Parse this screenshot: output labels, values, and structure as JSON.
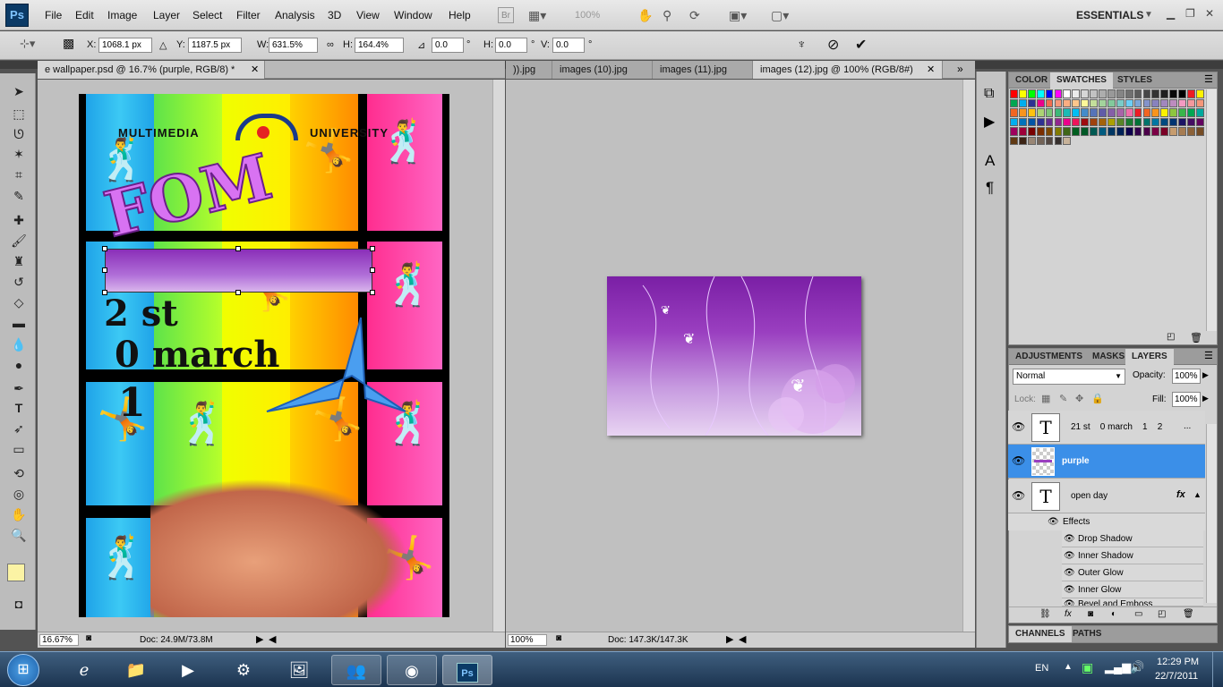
{
  "menubar": {
    "logo": "Ps",
    "items": [
      "File",
      "Edit",
      "Image",
      "Layer",
      "Select",
      "Filter",
      "Analysis",
      "3D",
      "View",
      "Window",
      "Help"
    ],
    "bridge_label": "Br",
    "zoom_value": "100%",
    "workspace": "ESSENTIALS"
  },
  "options": {
    "x_label": "X:",
    "x_value": "1068.1 px",
    "y_label": "Y:",
    "y_value": "1187.5 px",
    "w_label": "W:",
    "w_value": "631.5%",
    "h_label": "H:",
    "h_value": "164.4%",
    "angle_value": "0.0",
    "hskew_label": "H:",
    "hskew_value": "0.0",
    "vskew_label": "V:",
    "vskew_value": "0.0",
    "deg": "°"
  },
  "doc1": {
    "tab": "e wallpaper.psd @ 16.7% (purple, RGB/8) *",
    "zoom": "16.67%",
    "doc_info": "Doc: 24.9M/73.8M"
  },
  "poster": {
    "brand_left": "MULTIMEDIA",
    "brand_right": "UNIVERSITY",
    "title": "FOM",
    "date1": "2 st",
    "date2": "0 march",
    "date3": "1"
  },
  "doc2": {
    "tabs": [
      ")).jpg",
      "images (10).jpg",
      "images (11).jpg",
      "images (12).jpg @ 100% (RGB/8#)"
    ],
    "more": "»",
    "zoom": "100%",
    "doc_info": "Doc: 147.3K/147.3K"
  },
  "panel_top": {
    "tabs": [
      "COLOR",
      "SWATCHES",
      "STYLES"
    ]
  },
  "swatches": {
    "colors": [
      "#ff0000",
      "#ffff00",
      "#00ff00",
      "#00ffff",
      "#0000ff",
      "#ff00ff",
      "#ffffff",
      "#ebebeb",
      "#d6d6d6",
      "#c2c2c2",
      "#adadad",
      "#999999",
      "#858585",
      "#707070",
      "#5c5c5c",
      "#474747",
      "#333333",
      "#1f1f1f",
      "#0a0a0a",
      "#000000",
      "#ed1c24",
      "#fff200",
      "#00a651",
      "#00aeef",
      "#2e3192",
      "#ec008c",
      "#f26c4f",
      "#f7977a",
      "#fbad82",
      "#fdc68c",
      "#fff799",
      "#c4df9b",
      "#a3d39c",
      "#82ca9c",
      "#7accc8",
      "#6dcff6",
      "#7da7d8",
      "#8393ca",
      "#8882be",
      "#a187be",
      "#bc8cbf",
      "#f49ac1",
      "#f5989d",
      "#f69679",
      "#f26522",
      "#f7941d",
      "#ffc20e",
      "#acd373",
      "#7cc576",
      "#3cb878",
      "#1cbbb4",
      "#00bff3",
      "#448ccb",
      "#5674b9",
      "#605ca8",
      "#855fa8",
      "#a864a8",
      "#f06eaa",
      "#ed1c24",
      "#f26522",
      "#f7941d",
      "#fff200",
      "#8dc63f",
      "#39b54a",
      "#00a651",
      "#00a99d",
      "#00aeef",
      "#0072bc",
      "#0054a6",
      "#2e3192",
      "#662d91",
      "#92278f",
      "#ec008c",
      "#ed145b",
      "#9e0b0f",
      "#a0410d",
      "#a3620a",
      "#aba000",
      "#598527",
      "#197b30",
      "#007236",
      "#00746b",
      "#0076a3",
      "#004a80",
      "#003471",
      "#1b1464",
      "#440e62",
      "#630460",
      "#9e005d",
      "#9e0039",
      "#790000",
      "#7b2e00",
      "#7d4900",
      "#827b00",
      "#406618",
      "#005e20",
      "#005826",
      "#005952",
      "#005b7f",
      "#003663",
      "#002157",
      "#0d004c",
      "#32004b",
      "#4b0049",
      "#7b0046",
      "#7a0026",
      "#c69c6e",
      "#a67c52",
      "#8c6239",
      "#754c24",
      "#603913",
      "#3c2415",
      "#998675",
      "#736357",
      "#534741",
      "#362f2d",
      "#c7b299"
    ]
  },
  "panel_layers": {
    "tabs": [
      "ADJUSTMENTS",
      "MASKS",
      "LAYERS"
    ],
    "blend_mode": "Normal",
    "opacity_label": "Opacity:",
    "opacity_value": "100%",
    "lock_label": "Lock:",
    "fill_label": "Fill:",
    "fill_value": "100%",
    "layers": [
      {
        "name": "21 st    0 march    1    2",
        "thumb": "T",
        "extra": "..."
      },
      {
        "name": "purple",
        "thumb": "",
        "extra": ""
      },
      {
        "name": "open day",
        "thumb": "T",
        "extra": "fx"
      }
    ],
    "effects_label": "Effects",
    "effects": [
      "Drop Shadow",
      "Inner Shadow",
      "Outer Glow",
      "Inner Glow",
      "Bevel and Emboss"
    ]
  },
  "panel_bottom": {
    "tabs": [
      "CHANNELS",
      "PATHS"
    ]
  },
  "taskbar": {
    "lang": "EN",
    "time": "12:29 PM",
    "date": "22/7/2011"
  }
}
